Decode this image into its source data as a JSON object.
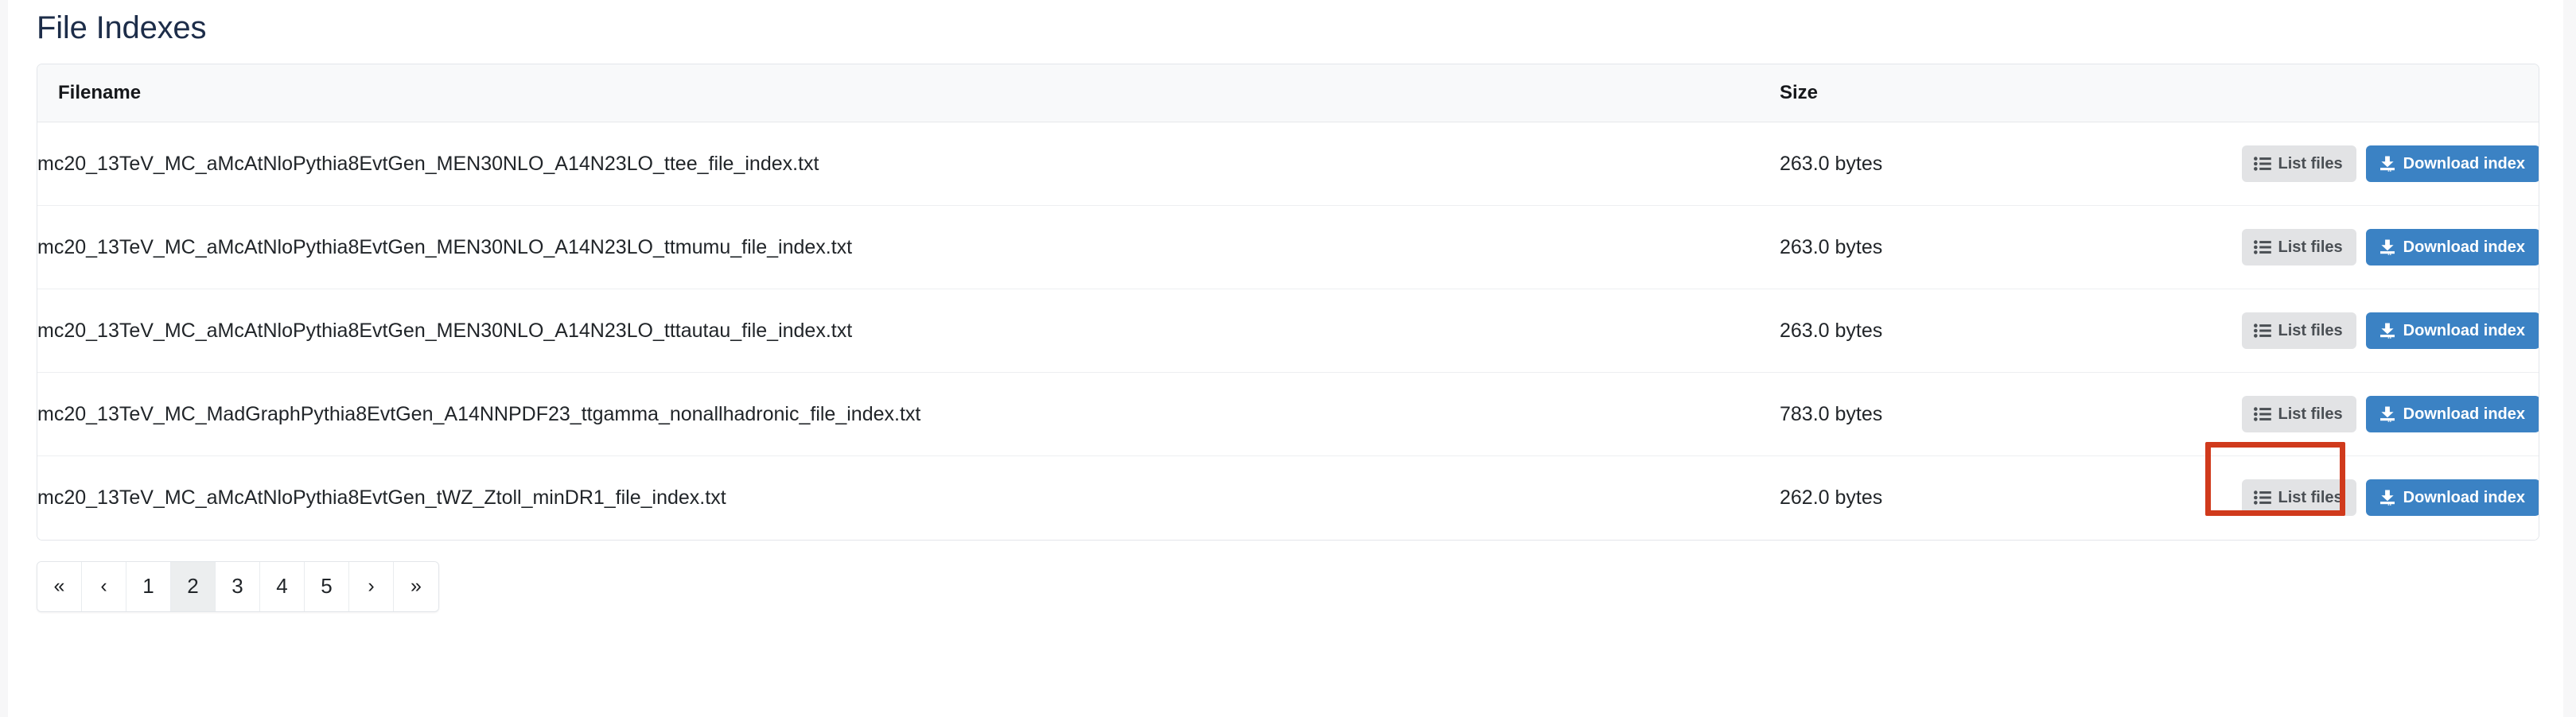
{
  "page": {
    "title": "File Indexes",
    "background": "#ffffff",
    "title_color": "#1d2d49"
  },
  "table": {
    "columns": [
      {
        "key": "filename",
        "label": "Filename"
      },
      {
        "key": "size",
        "label": "Size"
      },
      {
        "key": "actions",
        "label": ""
      }
    ],
    "rows": [
      {
        "filename": "mc20_13TeV_MC_aMcAtNloPythia8EvtGen_MEN30NLO_A14N23LO_ttee_file_index.txt",
        "size": "263.0 bytes",
        "list_label": "List files",
        "download_label": "Download index"
      },
      {
        "filename": "mc20_13TeV_MC_aMcAtNloPythia8EvtGen_MEN30NLO_A14N23LO_ttmumu_file_index.txt",
        "size": "263.0 bytes",
        "list_label": "List files",
        "download_label": "Download index"
      },
      {
        "filename": "mc20_13TeV_MC_aMcAtNloPythia8EvtGen_MEN30NLO_A14N23LO_tttautau_file_index.txt",
        "size": "263.0 bytes",
        "list_label": "List files",
        "download_label": "Download index"
      },
      {
        "filename": "mc20_13TeV_MC_MadGraphPythia8EvtGen_A14NNPDF23_ttgamma_nonallhadronic_file_index.txt",
        "size": "783.0 bytes",
        "list_label": "List files",
        "download_label": "Download index"
      },
      {
        "filename": "mc20_13TeV_MC_aMcAtNloPythia8EvtGen_tWZ_Ztoll_minDR1_file_index.txt",
        "size": "262.0 bytes",
        "list_label": "List files",
        "download_label": "Download index"
      }
    ]
  },
  "icons": {
    "list": "list-ul-icon",
    "download": "download-icon"
  },
  "colors": {
    "download_button": "#3b82c4",
    "list_button": "#e2e3e5",
    "header_row": "#f8f9fa",
    "highlight": "#d03a1c"
  },
  "highlight": {
    "target": "row-4-list-files-button"
  },
  "pagination": {
    "items": [
      {
        "label": "«",
        "name": "pagination-first",
        "active": false,
        "chevron": true
      },
      {
        "label": "‹",
        "name": "pagination-prev",
        "active": false,
        "chevron": true
      },
      {
        "label": "1",
        "name": "pagination-page-1",
        "active": false,
        "chevron": false
      },
      {
        "label": "2",
        "name": "pagination-page-2",
        "active": true,
        "chevron": false
      },
      {
        "label": "3",
        "name": "pagination-page-3",
        "active": false,
        "chevron": false
      },
      {
        "label": "4",
        "name": "pagination-page-4",
        "active": false,
        "chevron": false
      },
      {
        "label": "5",
        "name": "pagination-page-5",
        "active": false,
        "chevron": false
      },
      {
        "label": "›",
        "name": "pagination-next",
        "active": false,
        "chevron": true
      },
      {
        "label": "»",
        "name": "pagination-last",
        "active": false,
        "chevron": true
      }
    ],
    "current_page": "2"
  }
}
